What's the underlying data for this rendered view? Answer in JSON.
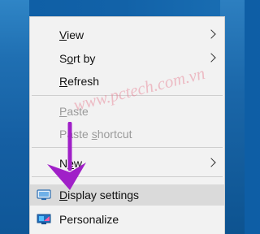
{
  "context_menu": {
    "items": [
      {
        "label": "View",
        "underline_index": 0,
        "enabled": true,
        "has_submenu": true
      },
      {
        "label": "Sort by",
        "underline_index": 1,
        "enabled": true,
        "has_submenu": true
      },
      {
        "label": "Refresh",
        "underline_index": 0,
        "enabled": true,
        "has_submenu": false
      },
      {
        "label": "Paste",
        "underline_index": 0,
        "enabled": false,
        "has_submenu": false
      },
      {
        "label": "Paste shortcut",
        "underline_index": 6,
        "enabled": false,
        "has_submenu": false
      },
      {
        "label": "New",
        "underline_index": 1,
        "enabled": true,
        "has_submenu": true
      },
      {
        "label": "Display settings",
        "underline_index": 0,
        "enabled": true,
        "has_submenu": false,
        "highlighted": true,
        "icon": "monitor-icon"
      },
      {
        "label": "Personalize",
        "underline_index": -1,
        "enabled": true,
        "has_submenu": false,
        "icon": "personalize-icon"
      }
    ]
  },
  "watermark": {
    "text": "www.pctech.com.vn"
  },
  "colors": {
    "arrow": "#a020c8",
    "watermark": "#e6788c",
    "menu_bg": "#f2f2f2",
    "highlight_bg": "#dadada",
    "desktop_blue": "#1262a8"
  }
}
